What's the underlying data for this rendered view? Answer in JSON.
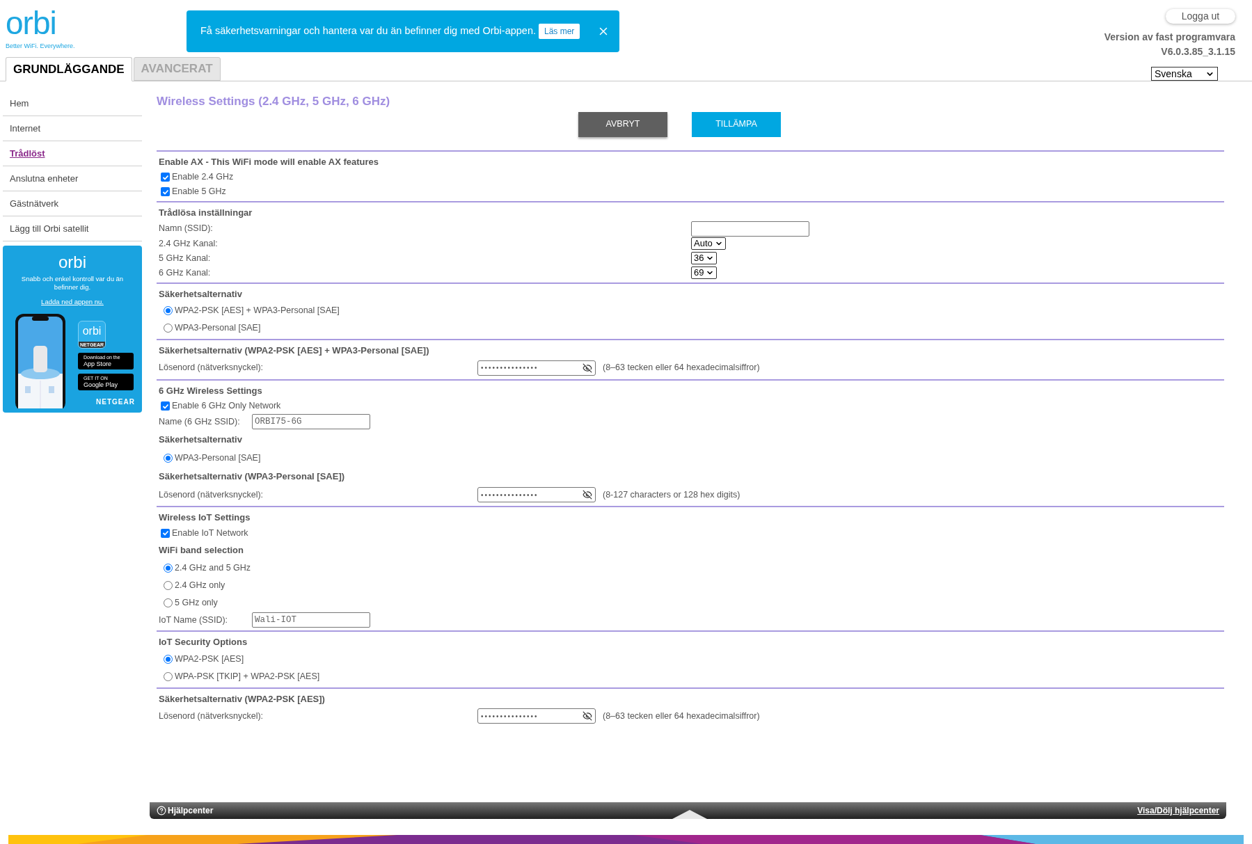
{
  "logo": {
    "text": "orbi",
    "tagline": "Better WiFi. Everywhere."
  },
  "banner": {
    "message": "Få säkerhetsvarningar och hantera var du än befinner dig med Orbi-appen.",
    "button": "Läs mer"
  },
  "tabs": [
    {
      "label": "GRUNDLÄGGANDE",
      "selected": true
    },
    {
      "label": "AVANCERAT",
      "selected": false
    }
  ],
  "logout": "Logga ut",
  "firmware": {
    "label": "Version av fast programvara",
    "version": "V6.0.3.85_3.1.15"
  },
  "language": "Svenska",
  "sidebar": {
    "items": [
      {
        "label": "Hem",
        "selected": false
      },
      {
        "label": "Internet",
        "selected": false
      },
      {
        "label": "Trådlöst",
        "selected": true
      },
      {
        "label": "Anslutna enheter",
        "selected": false
      },
      {
        "label": "Gästnätverk",
        "selected": false
      },
      {
        "label": "Lägg till Orbi satellit",
        "selected": false
      }
    ]
  },
  "promo": {
    "logo": "orbi",
    "text": "Snabb och enkel kontroll var du än befinner dig.",
    "link": "Ladda ned appen nu.",
    "app_icon_logo": "orbi",
    "app_icon_brand": "NETGEAR",
    "app_store": {
      "small": "Download on the",
      "big": "App Store"
    },
    "google_play": {
      "small": "GET IT ON",
      "big": "Google Play"
    },
    "brand": "NETGEAR"
  },
  "page_title": "Wireless Settings (2.4 GHz, 5 GHz, 6 GHz)",
  "buttons": [
    {
      "label": "AVBRYT",
      "kind": "cancel"
    },
    {
      "label": "TILLÄMPA",
      "kind": "apply"
    }
  ],
  "sections": [
    {
      "rows": [
        {
          "kind": "heading",
          "text": "Enable AX - This WiFi mode will enable AX features"
        },
        {
          "kind": "checkbox",
          "label": "Enable 2.4 GHz",
          "checked": true
        },
        {
          "kind": "checkbox",
          "label": "Enable 5 GHz",
          "checked": true
        }
      ]
    },
    {
      "rows": [
        {
          "kind": "heading",
          "text": "Trådlösa inställningar"
        },
        {
          "kind": "text_field",
          "label": "Namn (SSID):"
        },
        {
          "kind": "select",
          "label": "2.4 GHz Kanal:",
          "value": "Auto"
        },
        {
          "kind": "select",
          "label": "5 GHz Kanal:",
          "value": "36"
        },
        {
          "kind": "select",
          "label": "6 GHz Kanal:",
          "value": "69"
        }
      ]
    },
    {
      "rows": [
        {
          "kind": "heading",
          "text": "Säkerhetsalternativ"
        },
        {
          "kind": "radio",
          "label": "WPA2-PSK [AES] + WPA3-Personal [SAE]",
          "selected": true
        },
        {
          "kind": "radio",
          "label": "WPA3-Personal [SAE]",
          "selected": false
        }
      ]
    },
    {
      "rows": [
        {
          "kind": "heading",
          "text": "Säkerhetsalternativ (WPA2-PSK [AES] + WPA3-Personal [SAE])"
        },
        {
          "kind": "password",
          "label": "Lösenord (nätverksnyckel):",
          "value": "•••••••••••••••",
          "hint": "(8–63 tecken eller 64 hexadecimalsiffror)"
        }
      ]
    },
    {
      "rows": [
        {
          "kind": "heading",
          "text": "6 GHz Wireless Settings"
        },
        {
          "kind": "checkbox",
          "label": "Enable 6 GHz Only Network",
          "checked": true
        },
        {
          "kind": "inline_field",
          "label": "Name (6 GHz SSID):",
          "value": "ORBI75-6G"
        },
        {
          "kind": "subheading",
          "text": "Säkerhetsalternativ"
        },
        {
          "kind": "radio",
          "label": "WPA3-Personal [SAE]",
          "selected": true
        },
        {
          "kind": "subheading",
          "text": "Säkerhetsalternativ (WPA3-Personal [SAE])"
        },
        {
          "kind": "password",
          "label": "Lösenord (nätverksnyckel):",
          "value": "•••••••••••••••",
          "hint": "(8-127 characters or 128 hex digits)"
        }
      ]
    },
    {
      "rows": [
        {
          "kind": "heading",
          "text": "Wireless IoT Settings"
        },
        {
          "kind": "checkbox",
          "label": "Enable IoT Network",
          "checked": true
        },
        {
          "kind": "subheading",
          "text": "WiFi band selection"
        },
        {
          "kind": "radio",
          "label": "2.4 GHz and 5 GHz",
          "selected": true
        },
        {
          "kind": "radio",
          "label": "2.4 GHz only",
          "selected": false
        },
        {
          "kind": "radio",
          "label": "5 GHz only",
          "selected": false
        },
        {
          "kind": "inline_field",
          "label": "IoT Name (SSID):",
          "value": "Wali-IOT"
        }
      ]
    },
    {
      "rows": [
        {
          "kind": "heading",
          "text": "IoT Security Options"
        },
        {
          "kind": "radio",
          "label": "WPA2-PSK [AES]",
          "selected": true
        },
        {
          "kind": "radio",
          "label": "WPA-PSK [TKIP] + WPA2-PSK [AES]",
          "selected": false
        }
      ]
    },
    {
      "rows": [
        {
          "kind": "heading",
          "text": "Säkerhetsalternativ (WPA2-PSK [AES])"
        },
        {
          "kind": "password",
          "label": "Lösenord (nätverksnyckel):",
          "value": "•••••••••••••••",
          "hint": "(8–63 tecken eller 64 hexadecimalsiffror)"
        }
      ]
    }
  ],
  "help_bar": {
    "title": "Hjälpcenter",
    "toggle": "Visa/Dölj hjälpcenter"
  }
}
